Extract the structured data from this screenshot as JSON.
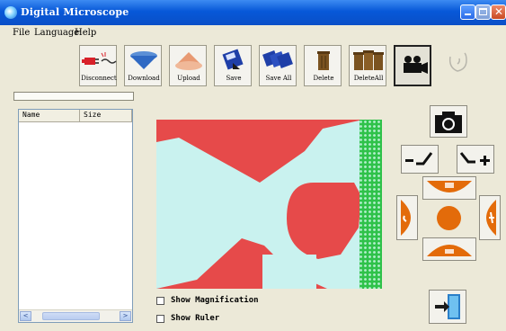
{
  "window": {
    "title": "Digital Microscope"
  },
  "menu": {
    "items": [
      "File",
      "Language",
      "Help"
    ]
  },
  "toolbar": {
    "buttons": [
      {
        "label": "Disconnect",
        "icon": "disconnect-plug-icon"
      },
      {
        "label": "Download",
        "icon": "download-arrow-icon"
      },
      {
        "label": "Upload",
        "icon": "upload-arrow-icon"
      },
      {
        "label": "Save",
        "icon": "save-disk-icon"
      },
      {
        "label": "Save All",
        "icon": "save-all-disks-icon"
      },
      {
        "label": "Delete",
        "icon": "trash-bin-icon"
      },
      {
        "label": "DeleteAll",
        "icon": "trash-bins-icon"
      },
      {
        "label": "",
        "icon": "video-camera-icon"
      },
      {
        "label": "",
        "icon": "hand-icon"
      }
    ]
  },
  "file_list": {
    "columns": [
      "Name",
      "Size"
    ],
    "rows": []
  },
  "options": {
    "show_magnification": {
      "label": "Show Magnification",
      "checked": false
    },
    "show_ruler": {
      "label": "Show Ruler",
      "checked": false
    }
  },
  "colors": {
    "accent": "#e36b0a",
    "title_bar": "#0a56d6",
    "preview_red": "#e64a4a",
    "preview_cyan": "#c9f2ef",
    "preview_green": "#2fc24a"
  }
}
